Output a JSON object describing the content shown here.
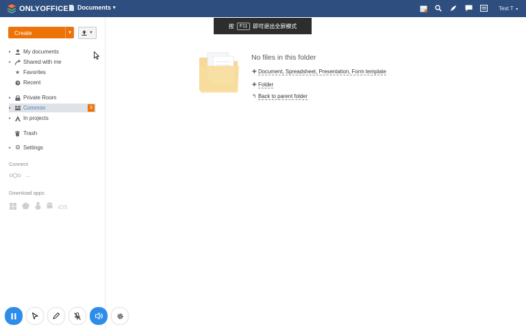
{
  "header": {
    "logo_text": "ONLYOFFICE",
    "module": "Documents",
    "user": "Test T"
  },
  "toast": {
    "pre": "按",
    "key": "F11",
    "post": "即可退出全屏模式"
  },
  "sidebar": {
    "create_label": "Create",
    "items": [
      {
        "label": "My documents",
        "icon": "person-icon",
        "expandable": true
      },
      {
        "label": "Shared with me",
        "icon": "share-icon",
        "expandable": true
      },
      {
        "label": "Favorites",
        "icon": "star-icon",
        "expandable": false
      },
      {
        "label": "Recent",
        "icon": "clock-icon",
        "expandable": false
      },
      {
        "label": "Private Room",
        "icon": "lock-icon",
        "expandable": true
      },
      {
        "label": "Common",
        "icon": "folder-group-icon",
        "expandable": true,
        "active": true,
        "badge": "3"
      },
      {
        "label": "In projects",
        "icon": "projects-icon",
        "expandable": true
      },
      {
        "label": "Trash",
        "icon": "trash-icon",
        "expandable": false
      },
      {
        "label": "Settings",
        "icon": "gear-icon",
        "expandable": true
      }
    ],
    "connect_label": "Connect",
    "connect_more": "...",
    "download_label": "Download apps",
    "ios_label": "iOS"
  },
  "main": {
    "empty_title": "No files in this folder",
    "create_types": "Document, Spreadsheet, Presentation, Form template",
    "folder_link": "Folder",
    "back_link": "Back to parent folder"
  },
  "colors": {
    "topbar": "#2d4e7e",
    "accent": "#ed7309",
    "active_text": "#4e7eb9",
    "record_blue": "#2f8dea"
  }
}
